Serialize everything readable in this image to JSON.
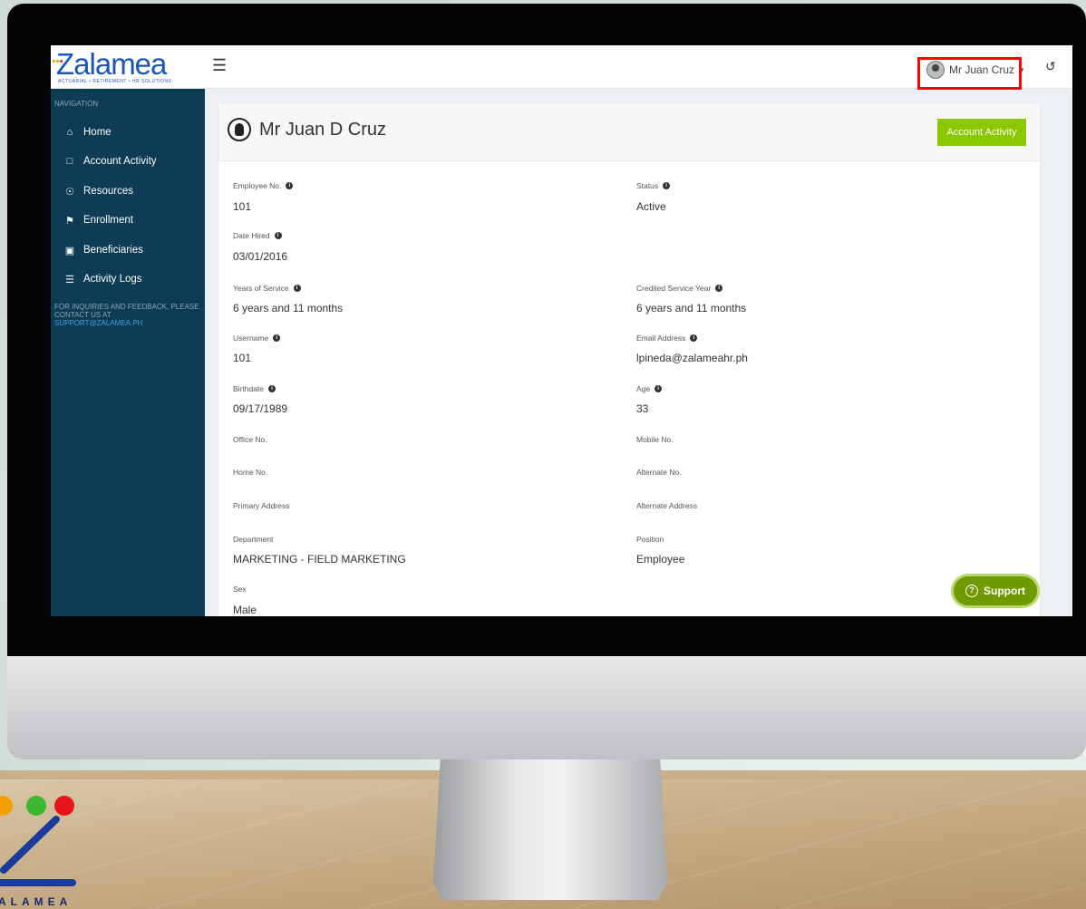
{
  "app": {
    "logo_text": "Zalamea",
    "logo_tagline": "ACTUARIAL  •  RETIREMENT  •  HR SOLUTIONS"
  },
  "topbar": {
    "user_name": "Mr Juan Cruz"
  },
  "sidebar": {
    "header": "NAVIGATION",
    "items": [
      {
        "label": "Home",
        "icon": "home-icon",
        "glyph": "⌂"
      },
      {
        "label": "Account Activity",
        "icon": "folder-open-icon",
        "glyph": "□"
      },
      {
        "label": "Resources",
        "icon": "lightbulb-icon",
        "glyph": "☉"
      },
      {
        "label": "Enrollment",
        "icon": "flag-icon",
        "glyph": "⚑"
      },
      {
        "label": "Beneficiaries",
        "icon": "gift-icon",
        "glyph": "▣"
      },
      {
        "label": "Activity Logs",
        "icon": "list-icon",
        "glyph": "☰"
      }
    ],
    "note": "FOR INQUIRIES AND FEEDBACK, PLEASE CONTACT US AT",
    "email": "SUPPORT@ZALAMEA.PH"
  },
  "profile": {
    "name": "Mr Juan D Cruz",
    "account_activity_label": "Account Activity",
    "fields": {
      "employee_no": {
        "label": "Employee No.",
        "value": "101"
      },
      "status": {
        "label": "Status",
        "value": "Active"
      },
      "date_hired": {
        "label": "Date Hired",
        "value": "03/01/2016"
      },
      "years_of_service": {
        "label": "Years of Service",
        "value": "6 years and 11 months"
      },
      "credited_service_year": {
        "label": "Credited Service Year",
        "value": "6 years and 11 months"
      },
      "username": {
        "label": "Username",
        "value": "101"
      },
      "email_address": {
        "label": "Email Address",
        "value": "lpineda@zalameahr.ph"
      },
      "birthdate": {
        "label": "Birthdate",
        "value": "09/17/1989"
      },
      "age": {
        "label": "Age",
        "value": "33"
      },
      "office_no": {
        "label": "Office No.",
        "value": ""
      },
      "mobile_no": {
        "label": "Mobile No.",
        "value": ""
      },
      "home_no": {
        "label": "Home No.",
        "value": ""
      },
      "alternate_no": {
        "label": "Alternate No.",
        "value": ""
      },
      "primary_address": {
        "label": "Primary Address",
        "value": ""
      },
      "alternate_address": {
        "label": "Alternate Address",
        "value": ""
      },
      "department": {
        "label": "Department",
        "value": "MARKETING - FIELD MARKETING"
      },
      "position": {
        "label": "Position",
        "value": "Employee"
      },
      "sex": {
        "label": "Sex",
        "value": "Male"
      }
    }
  },
  "support": {
    "label": "Support"
  },
  "brand_bottom": {
    "text": "ALAMEA"
  },
  "colors": {
    "sidebar_bg": "#0d3c54",
    "accent_green": "#8cc800",
    "support_green": "#6f9a00",
    "highlight_red": "#ff0000",
    "logo_blue": "#1a56b8"
  }
}
